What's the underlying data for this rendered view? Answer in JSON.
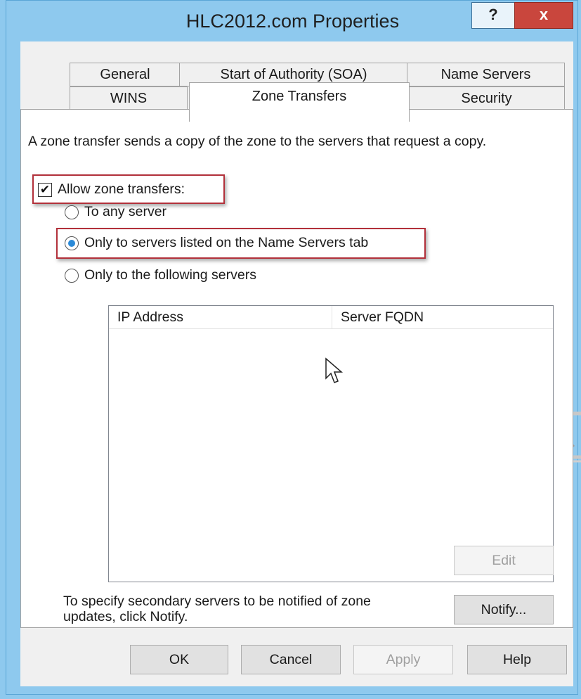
{
  "window": {
    "title": "HLC2012.com Properties",
    "help_label": "?",
    "close_label": "x"
  },
  "tabs": {
    "row_top": [
      {
        "label": "General"
      },
      {
        "label": "Start of Authority (SOA)"
      },
      {
        "label": "Name Servers"
      }
    ],
    "row_bottom": [
      {
        "label": "WINS"
      },
      {
        "label": "Zone Transfers",
        "active": true
      },
      {
        "label": "Security"
      }
    ]
  },
  "zone_transfers": {
    "description": "A zone transfer sends a copy of the zone to the servers that request a copy.",
    "allow_checkbox": {
      "label": "Allow zone transfers:",
      "checked": true
    },
    "radio_options": [
      {
        "label": "To any server",
        "selected": false
      },
      {
        "label": "Only to servers listed on the Name Servers tab",
        "selected": true
      },
      {
        "label": "Only to the following servers",
        "selected": false
      }
    ],
    "server_list": {
      "columns": [
        "IP Address",
        "Server FQDN"
      ],
      "rows": []
    },
    "edit_button": "Edit",
    "notify_text": "To specify secondary servers to be notified of zone updates, click Notify.",
    "notify_button": "Notify..."
  },
  "footer_buttons": {
    "ok": "OK",
    "cancel": "Cancel",
    "apply": "Apply",
    "help": "Help"
  },
  "colors": {
    "frame": "#8ec9ee",
    "close_button": "#c9463d",
    "highlight_border": "#b2303a",
    "radio_selected": "#2b8ad8"
  }
}
